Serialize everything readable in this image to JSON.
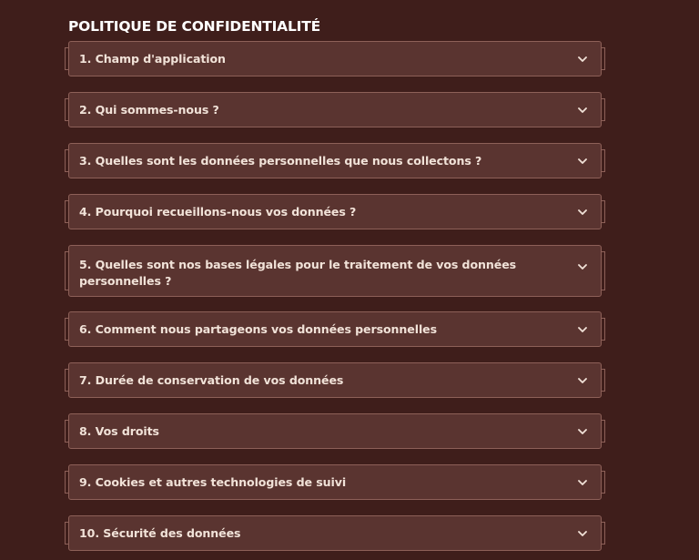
{
  "page": {
    "title": "POLITIQUE DE CONFIDENTIALITÉ"
  },
  "accordion": {
    "icon": "chevron-down-icon",
    "items": [
      {
        "label": "1. Champ d'application"
      },
      {
        "label": "2. Qui sommes-nous ?"
      },
      {
        "label": "3. Quelles sont les données personnelles que nous collectons ?"
      },
      {
        "label": "4. Pourquoi recueillons-nous vos données ?"
      },
      {
        "label": "5. Quelles sont nos bases légales pour le traitement de vos données personnelles ?"
      },
      {
        "label": "6. Comment nous partageons vos données personnelles"
      },
      {
        "label": "7. Durée de conservation de vos données"
      },
      {
        "label": "8. Vos droits"
      },
      {
        "label": "9. Cookies et autres technologies de suivi"
      },
      {
        "label": "10. Sécurité des données"
      }
    ]
  },
  "colors": {
    "background": "#3f1e1b",
    "panel": "#5a3430",
    "border": "#8d6058",
    "text": "#f1e2d8"
  }
}
